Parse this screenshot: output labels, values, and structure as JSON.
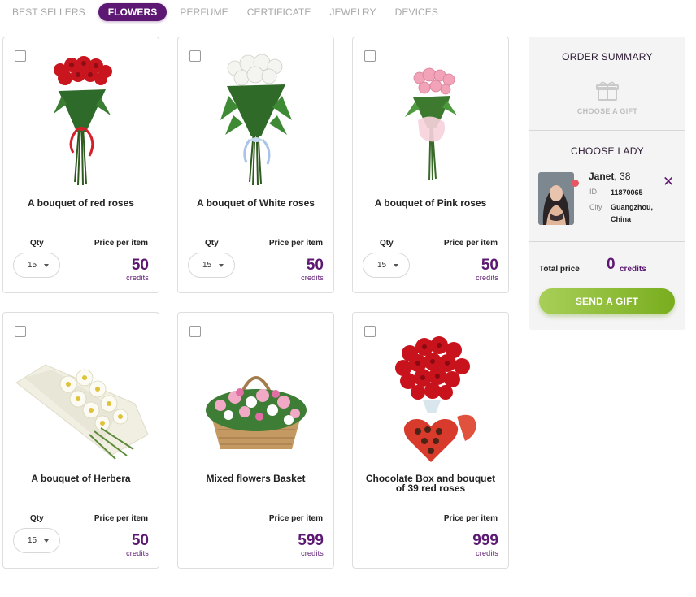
{
  "tabs": [
    {
      "label": "BEST SELLERS",
      "active": false
    },
    {
      "label": "FLOWERS",
      "active": true
    },
    {
      "label": "PERFUME",
      "active": false
    },
    {
      "label": "CERTIFICATE",
      "active": false
    },
    {
      "label": "JEWELRY",
      "active": false
    },
    {
      "label": "DEVICES",
      "active": false
    }
  ],
  "products": [
    {
      "name": "A bouquet of red roses",
      "qty_label": "Qty",
      "qty": "15",
      "price_label": "Price per item",
      "price": "50",
      "currency": "credits",
      "image": "red-roses-image"
    },
    {
      "name": "A bouquet of White roses",
      "qty_label": "Qty",
      "qty": "15",
      "price_label": "Price per item",
      "price": "50",
      "currency": "credits",
      "image": "white-roses-image"
    },
    {
      "name": "A bouquet of Pink roses",
      "qty_label": "Qty",
      "qty": "15",
      "price_label": "Price per item",
      "price": "50",
      "currency": "credits",
      "image": "pink-roses-image"
    },
    {
      "name": "A bouquet of Herbera",
      "qty_label": "Qty",
      "qty": "15",
      "price_label": "Price per item",
      "price": "50",
      "currency": "credits",
      "image": "gerbera-image"
    },
    {
      "name": "Mixed flowers Basket",
      "price_label": "Price per item",
      "price": "599",
      "currency": "credits",
      "image": "flower-basket-image"
    },
    {
      "name": "Chocolate Box and bouquet of 39 red roses",
      "price_label": "Price per item",
      "price": "999",
      "currency": "credits",
      "image": "roses-chocolate-image"
    }
  ],
  "sidebar": {
    "order_summary": "ORDER SUMMARY",
    "choose_gift": "CHOOSE A GIFT",
    "choose_lady": "CHOOSE LADY",
    "lady": {
      "name": "Janet",
      "age": ", 38",
      "id_label": "ID",
      "id": "11870065",
      "city_label": "City",
      "city_line1": "Guangzhou,",
      "city_line2": "China"
    },
    "total_label": "Total price",
    "total_value": "0",
    "total_currency": "credits",
    "send_button": "SEND A GIFT"
  },
  "colors": {
    "brand": "#5c1872",
    "button_start": "#a8cf58",
    "button_end": "#79ad1e",
    "online": "#e85664"
  }
}
